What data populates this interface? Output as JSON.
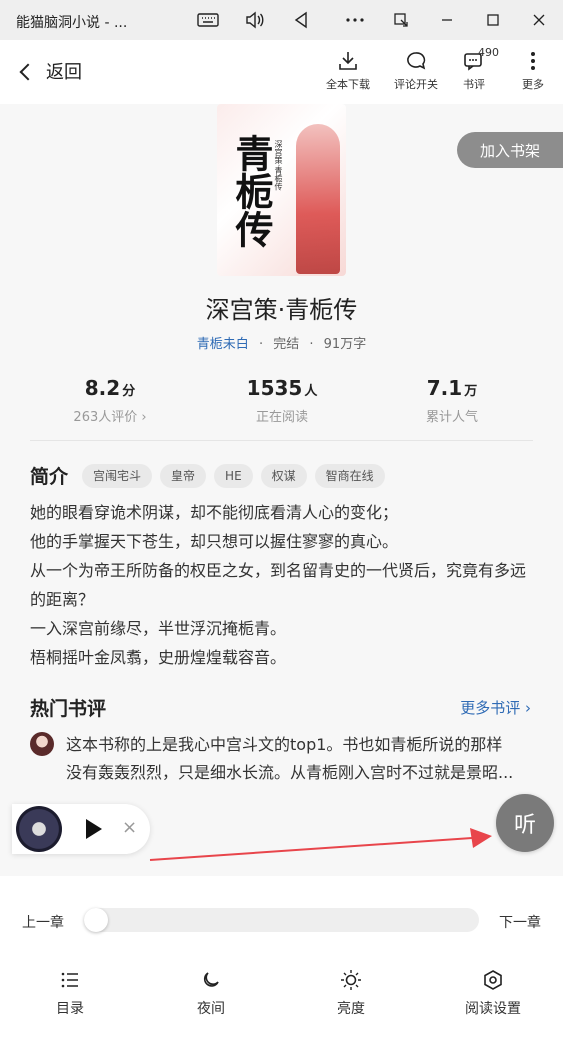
{
  "window": {
    "title": "能猫脑洞小说 - ...",
    "icons": [
      "keyboard-icon",
      "volume-icon",
      "back-triangle-icon",
      "more-dots-icon",
      "snap-icon",
      "minimize-icon",
      "maximize-icon",
      "close-icon"
    ]
  },
  "appbar": {
    "back_label": "返回",
    "actions": [
      {
        "label": "全本下载",
        "icon": "download-icon"
      },
      {
        "label": "评论开关",
        "icon": "comment-icon"
      },
      {
        "label": "书评",
        "icon": "review-icon",
        "badge": "490"
      },
      {
        "label": "更多",
        "icon": "more-vert-icon"
      }
    ]
  },
  "book": {
    "cover_title": "青栀传",
    "cover_small": "深宫策·青栀传",
    "cover_author": "青栀未白",
    "add_to_shelf": "加入书架",
    "title": "深宫策·青栀传",
    "author": "青栀未白",
    "status": "完结",
    "words": "91万字",
    "sep": "·"
  },
  "stats": [
    {
      "value": "8.2",
      "unit": "分",
      "label": "263人评价 ›"
    },
    {
      "value": "1535",
      "unit": "人",
      "label": "正在阅读"
    },
    {
      "value": "7.1",
      "unit": "万",
      "label": "累计人气"
    }
  ],
  "intro": {
    "heading": "简介",
    "tags": [
      "宫闱宅斗",
      "皇帝",
      "HE",
      "权谋",
      "智商在线"
    ],
    "lines": [
      "她的眼看穿诡术阴谋，却不能彻底看清人心的变化；",
      "他的手掌握天下苍生，却只想可以握住寥寥的真心。",
      "从一个为帝王所防备的权臣之女，到名留青史的一代贤后，究竟有多远的距离？",
      "一入深宫前缘尽，半世浮沉掩栀青。",
      "梧桐摇叶金凤翥，史册煌煌载容音。"
    ]
  },
  "reviews": {
    "heading": "热门书评",
    "more": "更多书评 ›",
    "line1": "这本书称的上是我心中宫斗文的top1。书也如青栀所说的那样",
    "line2": "没有轰轰烈烈，只是细水长流。从青栀刚入宫时不过就是景昭..."
  },
  "player": {
    "close": "×"
  },
  "listen": "听",
  "reader": {
    "prev": "上一章",
    "next": "下一章",
    "progress": 0,
    "nav": [
      {
        "label": "目录",
        "icon": "list-icon"
      },
      {
        "label": "夜间",
        "icon": "moon-icon"
      },
      {
        "label": "亮度",
        "icon": "brightness-icon"
      },
      {
        "label": "阅读设置",
        "icon": "settings-icon"
      }
    ]
  },
  "colors": {
    "link": "#2f6bb5",
    "arrow": "#e8454b",
    "shelf_button": "#8d8d8d"
  }
}
